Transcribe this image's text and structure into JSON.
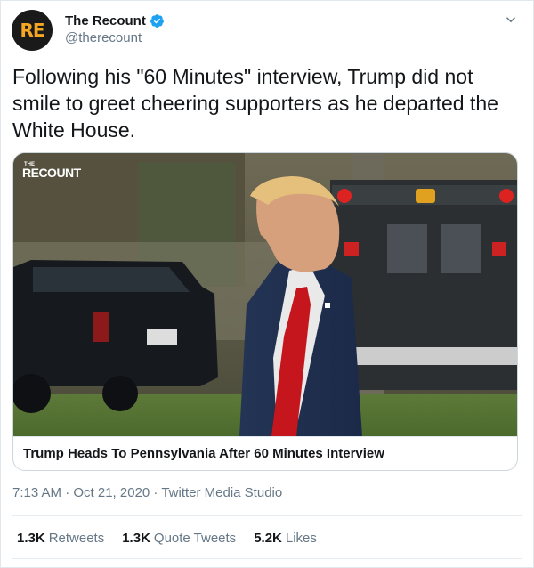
{
  "account": {
    "display_name": "The Recount",
    "handle": "@therecount",
    "avatar_text": "RE"
  },
  "tweet": {
    "text": "Following his \"60 Minutes\" interview, Trump did not smile to greet cheering supporters as he departed the White House."
  },
  "media": {
    "watermark_small": "THE",
    "watermark": "RECOUNT",
    "caption": "Trump Heads To Pennsylvania After 60 Minutes Interview"
  },
  "meta": {
    "line": "7:13 AM · Oct 21, 2020 · Twitter Media Studio"
  },
  "stats": {
    "retweets_count": "1.3K",
    "retweets_label": "Retweets",
    "quote_count": "1.3K",
    "quote_label": "Quote Tweets",
    "likes_count": "5.2K",
    "likes_label": "Likes"
  },
  "colors": {
    "verified": "#1da1f2",
    "avatar_bg": "#1a1a1a",
    "avatar_fg": "#f5a623",
    "secondary_text": "#657786"
  }
}
